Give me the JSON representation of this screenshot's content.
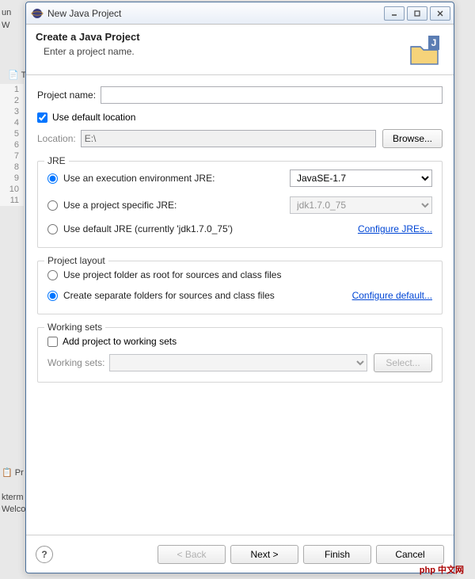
{
  "window": {
    "title": "New Java Project"
  },
  "banner": {
    "title": "Create a Java Project",
    "message": "Enter a project name."
  },
  "form": {
    "projectNameLabel": "Project name:",
    "projectNameValue": "",
    "useDefaultLocationLabel": "Use default location",
    "locationLabel": "Location:",
    "locationValue": "E:\\",
    "browseLabel": "Browse..."
  },
  "jre": {
    "legend": "JRE",
    "opt1": "Use an execution environment JRE:",
    "opt1Value": "JavaSE-1.7",
    "opt2": "Use a project specific JRE:",
    "opt2Value": "jdk1.7.0_75",
    "opt3": "Use default JRE (currently 'jdk1.7.0_75')",
    "configureLink": "Configure JREs..."
  },
  "layout": {
    "legend": "Project layout",
    "opt1": "Use project folder as root for sources and class files",
    "opt2": "Create separate folders for sources and class files",
    "configureLink": "Configure default..."
  },
  "workingSets": {
    "legend": "Working sets",
    "addLabel": "Add project to working sets",
    "wsLabel": "Working sets:",
    "selectLabel": "Select..."
  },
  "footer": {
    "back": "< Back",
    "next": "Next >",
    "finish": "Finish",
    "cancel": "Cancel"
  },
  "lineNumbers": [
    "1",
    "2",
    "3",
    "4",
    "5",
    "6",
    "7",
    "8",
    "9",
    "10",
    "11"
  ],
  "sideItems": {
    "pr": "Pr",
    "kterm": "kterm",
    "welco": "Welco",
    "te": "Te",
    "un": "un",
    "w": "W"
  },
  "overlay": "中文网"
}
